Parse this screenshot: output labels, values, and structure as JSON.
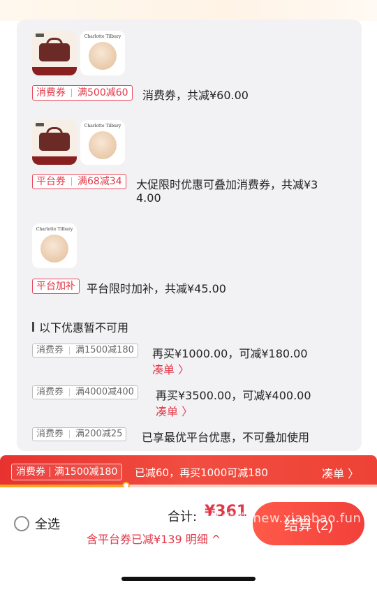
{
  "coupons": [
    {
      "tag_type": "消费券",
      "tag_rule": "满500减60",
      "description": "消费券，共减¥60.00",
      "items": [
        "bag-product-image",
        "compact-product-image"
      ]
    },
    {
      "tag_type": "平台券",
      "tag_rule": "满68减34",
      "description_line1": "大促限时优惠可叠加消费券，共减¥3",
      "description_line2": "4.00",
      "items": [
        "bag-product-image",
        "compact-product-image"
      ]
    },
    {
      "tag_type": "平台加补",
      "description": "平台限时加补，共减¥45.00",
      "items": [
        "compact-product-image"
      ]
    }
  ],
  "unavailable": {
    "title": "以下优惠暂不可用",
    "items": [
      {
        "tag_type": "消费券",
        "tag_rule": "满1500减180",
        "description": "再买¥1000.00，可减¥180.00",
        "link": "凑单 〉"
      },
      {
        "tag_type": "消费券",
        "tag_rule": "满4000减400",
        "description": "再买¥3500.00，可减¥400.00",
        "link": "凑单 〉"
      },
      {
        "tag_type": "消费券",
        "tag_rule": "满200减25",
        "description": "已享最优平台优惠，不可叠加使用"
      }
    ]
  },
  "product_brand_text": "Charlotte Tilbury",
  "banner": {
    "tag_type": "消费券",
    "tag_rule": "满1500减180",
    "text": "已减60，再买1000可减180",
    "link": "凑单 〉",
    "progress_fraction": 0.335
  },
  "footer": {
    "select_all": "全选",
    "total_label": "合计:",
    "total_value": "¥361",
    "discount_line": "含平台券已减¥139  明细 ^",
    "checkout": "结算 (2)",
    "watermark": "线报酷-new.xianbao.fun"
  },
  "colors": {
    "accent": "#e23848",
    "banner": "#ee3e35",
    "progress": "#f6a623"
  }
}
